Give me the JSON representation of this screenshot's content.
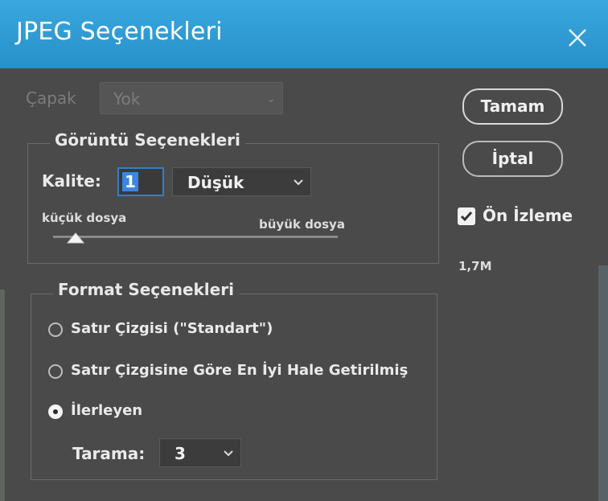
{
  "window": {
    "title": "JPEG Seçenekleri"
  },
  "matte": {
    "label": "Çapak",
    "value": "Yok"
  },
  "image_options": {
    "title": "Görüntü Seçenekleri",
    "quality_label": "Kalite:",
    "quality_value": "1",
    "quality_preset": "Düşük",
    "slider_min_label": "küçük dosya",
    "slider_max_label": "büyük dosya"
  },
  "format_options": {
    "title": "Format Seçenekleri",
    "options": [
      {
        "label": "Satır Çizgisi (\"Standart\")",
        "selected": false
      },
      {
        "label": "Satır Çizgisine Göre En İyi Hale Getirilmiş",
        "selected": false
      },
      {
        "label": "İlerleyen",
        "selected": true
      }
    ],
    "scans_label": "Tarama:",
    "scans_value": "3"
  },
  "actions": {
    "ok_label": "Tamam",
    "cancel_label": "İptal"
  },
  "preview": {
    "label": "Ön İzleme",
    "checked": true,
    "file_size": "1,7M"
  },
  "colors": {
    "title_bar": "#2b9ad3",
    "panel": "#4a4a4a",
    "accent": "#3b86e0"
  }
}
